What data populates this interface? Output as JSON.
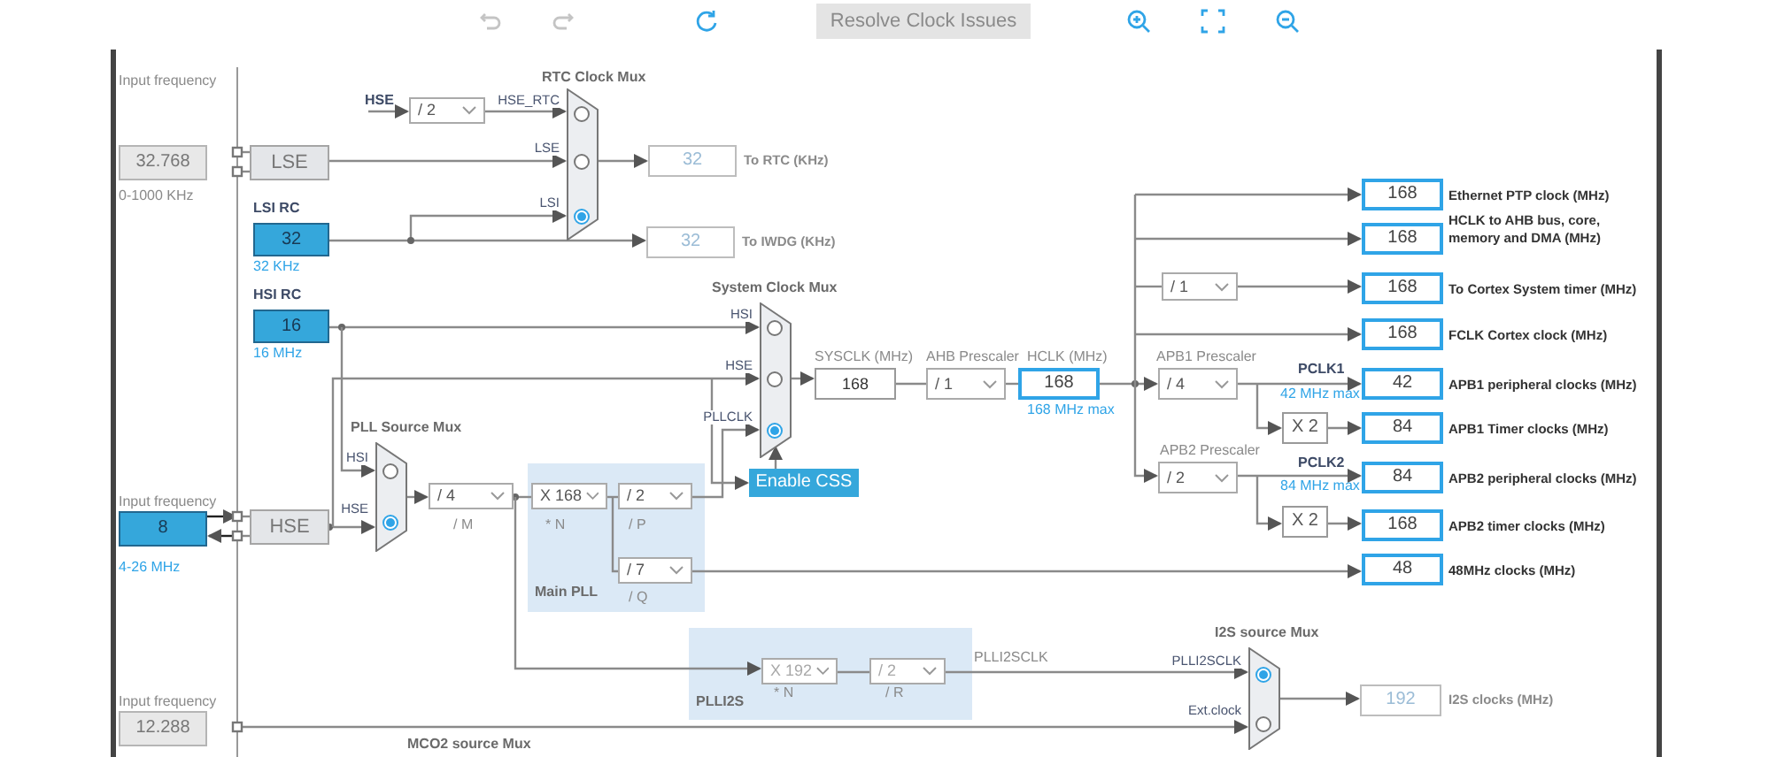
{
  "toolbar": {
    "undo": {
      "disabled": true
    },
    "redo": {
      "disabled": true
    },
    "resolve_button": {
      "label": "Resolve Clock Issues",
      "disabled": true
    }
  },
  "diagram": {
    "elements": [
      {
        "kind": "label",
        "text": "Input frequency"
      },
      {
        "kind": "input",
        "value": "32.768",
        "disabled": true
      },
      {
        "kind": "label",
        "text": "0-1000 KHz"
      },
      {
        "kind": "block",
        "text": "LSE"
      },
      {
        "kind": "signal",
        "text": "HSE"
      },
      {
        "kind": "dropdown",
        "value": "/ 2",
        "disabled": false
      },
      {
        "kind": "title",
        "text": "RTC Clock Mux"
      },
      {
        "kind": "mux",
        "inputs": [
          {
            "label": "HSE_RTC",
            "selected": false
          },
          {
            "label": "LSE",
            "selected": false
          },
          {
            "label": "LSI",
            "selected": true
          }
        ]
      },
      {
        "kind": "output",
        "value": "32",
        "disabled": true
      },
      {
        "kind": "output_label",
        "text": "To RTC (KHz)",
        "disabled": true
      },
      {
        "kind": "signal",
        "text": "LSI RC"
      },
      {
        "kind": "input",
        "value": "32",
        "disabled": false
      },
      {
        "kind": "note",
        "text": "32 KHz"
      },
      {
        "kind": "output",
        "value": "32",
        "disabled": true
      },
      {
        "kind": "output_label",
        "text": "To IWDG (KHz)",
        "disabled": true
      },
      {
        "kind": "signal",
        "text": "HSI RC"
      },
      {
        "kind": "input",
        "value": "16",
        "disabled": false
      },
      {
        "kind": "note",
        "text": "16 MHz"
      },
      {
        "kind": "title",
        "text": "System Clock Mux"
      },
      {
        "kind": "mux",
        "inputs": [
          {
            "label": "HSI",
            "selected": false
          },
          {
            "label": "HSE",
            "selected": false
          },
          {
            "label": "PLLCLK",
            "selected": true
          }
        ]
      },
      {
        "kind": "label",
        "text": "SYSCLK (MHz)"
      },
      {
        "kind": "value",
        "value": "168"
      },
      {
        "kind": "label",
        "text": "AHB Prescaler"
      },
      {
        "kind": "dropdown",
        "value": "/ 1",
        "disabled": false
      },
      {
        "kind": "label",
        "text": "HCLK (MHz)"
      },
      {
        "kind": "output",
        "value": "168",
        "disabled": false
      },
      {
        "kind": "note",
        "text": "168 MHz max"
      },
      {
        "kind": "button",
        "label": "Enable CSS"
      },
      {
        "kind": "label",
        "text": "Input frequency"
      },
      {
        "kind": "input",
        "value": "8",
        "disabled": false
      },
      {
        "kind": "note",
        "text": "4-26 MHz"
      },
      {
        "kind": "block",
        "text": "HSE"
      },
      {
        "kind": "title",
        "text": "PLL Source Mux"
      },
      {
        "kind": "mux",
        "inputs": [
          {
            "label": "HSI",
            "selected": false
          },
          {
            "label": "HSE",
            "selected": true
          }
        ]
      },
      {
        "kind": "dropdown",
        "value": "/ 4",
        "disabled": false
      },
      {
        "kind": "label",
        "text": "/ M"
      },
      {
        "kind": "dropdown",
        "value": "X 168",
        "disabled": false
      },
      {
        "kind": "label",
        "text": "* N"
      },
      {
        "kind": "dropdown",
        "value": "/ 2",
        "disabled": false
      },
      {
        "kind": "label",
        "text": "/ P"
      },
      {
        "kind": "dropdown",
        "value": "/ 7",
        "disabled": false
      },
      {
        "kind": "label",
        "text": "/ Q"
      },
      {
        "kind": "title",
        "text": "Main PLL"
      },
      {
        "kind": "label",
        "text": "Input frequency"
      },
      {
        "kind": "input",
        "value": "12.288",
        "disabled": true
      },
      {
        "kind": "dropdown",
        "value": "X 192",
        "disabled": true
      },
      {
        "kind": "label",
        "text": "* N"
      },
      {
        "kind": "dropdown",
        "value": "/ 2",
        "disabled": true
      },
      {
        "kind": "label",
        "text": "/ R"
      },
      {
        "kind": "title",
        "text": "PLLI2S"
      },
      {
        "kind": "label",
        "text": "PLLI2SCLK"
      },
      {
        "kind": "title",
        "text": "I2S source Mux"
      },
      {
        "kind": "mux",
        "inputs": [
          {
            "label": "PLLI2SCLK",
            "selected": true
          },
          {
            "label": "Ext.clock",
            "selected": false
          }
        ]
      },
      {
        "kind": "output",
        "value": "192",
        "disabled": true
      },
      {
        "kind": "output_label",
        "text": "I2S clocks (MHz)",
        "disabled": true
      },
      {
        "kind": "title",
        "text": "MCO2 source Mux"
      },
      {
        "kind": "dropdown",
        "value": "/ 1",
        "disabled": false
      },
      {
        "kind": "label",
        "text": "APB1 Prescaler"
      },
      {
        "kind": "dropdown",
        "value": "/ 4",
        "disabled": false
      },
      {
        "kind": "signal",
        "text": "PCLK1"
      },
      {
        "kind": "note",
        "text": "42 MHz max"
      },
      {
        "kind": "multiplier",
        "text": "X 2"
      },
      {
        "kind": "label",
        "text": "APB2 Prescaler"
      },
      {
        "kind": "dropdown",
        "value": "/ 2",
        "disabled": false
      },
      {
        "kind": "signal",
        "text": "PCLK2"
      },
      {
        "kind": "note",
        "text": "84 MHz max"
      },
      {
        "kind": "multiplier",
        "text": "X 2"
      },
      {
        "kind": "output",
        "value": "168",
        "disabled": false
      },
      {
        "kind": "output_label",
        "text": "Ethernet PTP clock (MHz)",
        "disabled": false
      },
      {
        "kind": "output",
        "value": "168",
        "disabled": false
      },
      {
        "kind": "output_label",
        "text": "HCLK to AHB bus, core, memory and DMA (MHz)",
        "disabled": false
      },
      {
        "kind": "output",
        "value": "168",
        "disabled": false
      },
      {
        "kind": "output_label",
        "text": "To Cortex System timer (MHz)",
        "disabled": false
      },
      {
        "kind": "output",
        "value": "168",
        "disabled": false
      },
      {
        "kind": "output_label",
        "text": "FCLK Cortex clock (MHz)",
        "disabled": false
      },
      {
        "kind": "output",
        "value": "42",
        "disabled": false
      },
      {
        "kind": "output_label",
        "text": "APB1 peripheral clocks (MHz)",
        "disabled": false
      },
      {
        "kind": "output",
        "value": "84",
        "disabled": false
      },
      {
        "kind": "output_label",
        "text": "APB1 Timer clocks (MHz)",
        "disabled": false
      },
      {
        "kind": "output",
        "value": "84",
        "disabled": false
      },
      {
        "kind": "output_label",
        "text": "APB2 peripheral clocks (MHz)",
        "disabled": false
      },
      {
        "kind": "output",
        "value": "168",
        "disabled": false
      },
      {
        "kind": "output_label",
        "text": "APB2 timer clocks (MHz)",
        "disabled": false
      },
      {
        "kind": "output",
        "value": "48",
        "disabled": false
      },
      {
        "kind": "output_label",
        "text": "48MHz clocks (MHz)",
        "disabled": false
      }
    ]
  }
}
